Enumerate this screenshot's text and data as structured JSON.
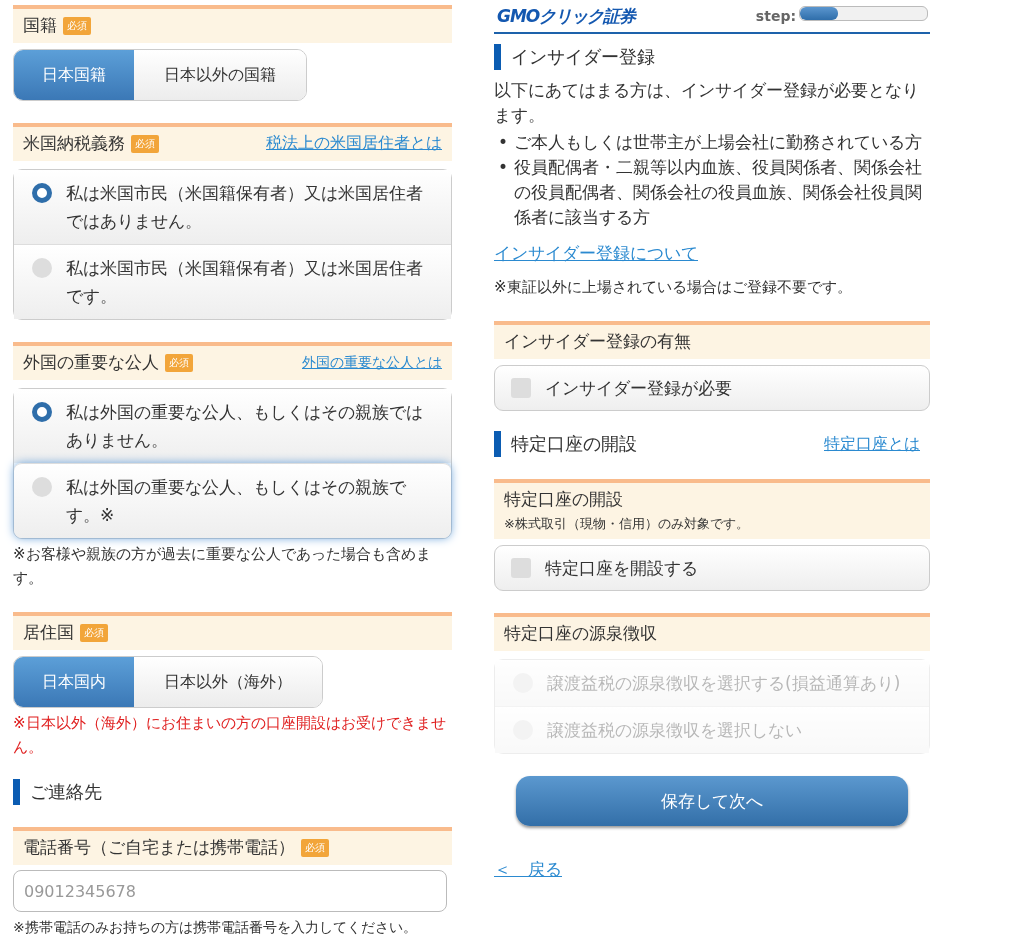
{
  "left": {
    "blocks": [
      {
        "kind": "label",
        "title": "国籍",
        "badge": "必須"
      },
      {
        "kind": "toggle",
        "options": [
          {
            "label": "日本国籍",
            "selected": true
          },
          {
            "label": "日本以外の国籍",
            "selected": false
          }
        ]
      },
      {
        "kind": "label",
        "title": "米国納税義務",
        "badge": "必須",
        "link": "税法上の米国居住者とは"
      },
      {
        "kind": "radios",
        "disabled": false,
        "options": [
          {
            "label": "私は米国市民（米国籍保有者）又は米国居住者ではありません。",
            "selected": true,
            "focused": false
          },
          {
            "label": "私は米国市民（米国籍保有者）又は米国居住者です。",
            "selected": false,
            "focused": false
          }
        ]
      },
      {
        "kind": "label",
        "title": "外国の重要な公人",
        "badge": "必須",
        "link": "外国の重要な公人とは",
        "small_link": true
      },
      {
        "kind": "radios",
        "disabled": false,
        "options": [
          {
            "label": "私は外国の重要な公人、もしくはその親族ではありません。",
            "selected": true,
            "focused": false
          },
          {
            "label": "私は外国の重要な公人、もしくはその親族です。※",
            "selected": false,
            "focused": true
          }
        ]
      },
      {
        "kind": "note",
        "text": "※お客様や親族の方が過去に重要な公人であった場合も含めます。"
      },
      {
        "kind": "label",
        "title": "居住国",
        "badge": "必須"
      },
      {
        "kind": "toggle",
        "options": [
          {
            "label": "日本国内",
            "selected": true
          },
          {
            "label": "日本以外（海外）",
            "selected": false
          }
        ]
      },
      {
        "kind": "alert_note",
        "text": "※日本以外（海外）にお住まいの方の口座開設はお受けできません。"
      },
      {
        "kind": "heading",
        "text": "ご連絡先"
      },
      {
        "kind": "label",
        "title": "電話番号（ご自宅または携帯電話）",
        "badge": "必須"
      },
      {
        "kind": "input",
        "placeholder": "09012345678"
      },
      {
        "kind": "small_note",
        "text": "※携帯電話のみお持ちの方は携帯電話番号を入力してください。"
      }
    ]
  },
  "right": {
    "header": {
      "logo": "GMOクリック証券",
      "step_label": "step:",
      "level": 0.3
    },
    "blocks": [
      {
        "kind": "heading",
        "text": "インサイダー登録"
      },
      {
        "kind": "paragraph",
        "text": "以下にあてはまる方は、インサイダー登録が必要となります。"
      },
      {
        "kind": "bullets",
        "items": [
          {
            "marker": "•",
            "text": "ご本人もしくは世帯主が上場会社に勤務されている方"
          },
          {
            "marker": "•",
            "text": "役員配偶者・二親等以内血族、役員関係者、関係会社の役員配偶者、関係会社の役員血族、関係会社役員関係者に該当する方"
          }
        ]
      },
      {
        "kind": "link",
        "text": "インサイダー登録について"
      },
      {
        "kind": "note",
        "text": "※東証以外に上場されている場合はご登録不要です。"
      },
      {
        "kind": "label",
        "title": "インサイダー登録の有無"
      },
      {
        "kind": "checkbox",
        "label": "インサイダー登録が必要",
        "checked": false
      },
      {
        "kind": "heading",
        "text": "特定口座の開設",
        "link": "特定口座とは"
      },
      {
        "kind": "label",
        "title": "特定口座の開設",
        "subnote": "※株式取引（現物・信用）のみ対象です。"
      },
      {
        "kind": "checkbox",
        "label": "特定口座を開設する",
        "checked": false
      },
      {
        "kind": "label",
        "title": "特定口座の源泉徴収"
      },
      {
        "kind": "radios",
        "disabled": true,
        "options": [
          {
            "label": "譲渡益税の源泉徴収を選択する(損益通算あり)",
            "selected": false,
            "focused": false
          },
          {
            "label": "譲渡益税の源泉徴収を選択しない",
            "selected": false,
            "focused": false
          }
        ]
      },
      {
        "kind": "button",
        "text": "保存して次へ"
      },
      {
        "kind": "back",
        "text": "＜　戻る"
      }
    ]
  }
}
